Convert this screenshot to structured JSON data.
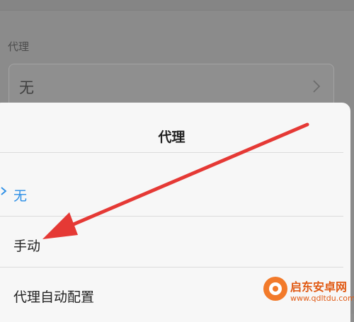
{
  "background": {
    "section_label": "代理",
    "proxy_value": "无"
  },
  "sheet": {
    "title": "代理",
    "options": [
      {
        "label": "无",
        "selected": true
      },
      {
        "label": "手动",
        "selected": false
      },
      {
        "label": "代理自动配置",
        "selected": false
      }
    ]
  },
  "watermark": {
    "name": "启东安卓网",
    "url": "www.qdltdu.com"
  },
  "colors": {
    "accent": "#2b8ee6",
    "arrow": "#e53935",
    "overlay": "#8b8b8b"
  }
}
